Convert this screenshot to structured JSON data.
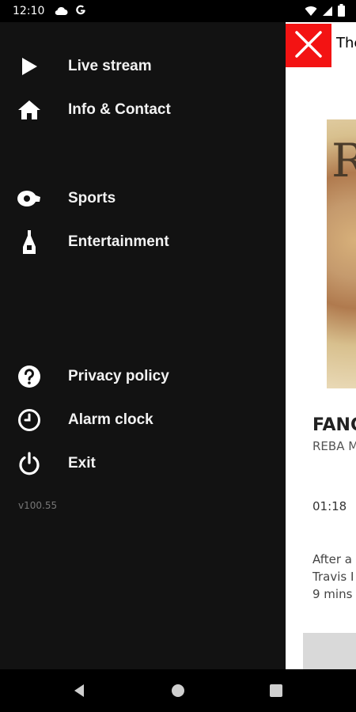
{
  "status_bar": {
    "time": "12:10",
    "left_icons": [
      "cloud-icon",
      "google-g-icon"
    ],
    "right_icons": [
      "wifi-icon",
      "signal-icon",
      "battery-icon"
    ]
  },
  "drawer": {
    "items": [
      {
        "label": "Live stream",
        "icon": "play-icon"
      },
      {
        "label": "Info & Contact",
        "icon": "home-icon"
      },
      {
        "label": "Sports",
        "icon": "whistle-icon"
      },
      {
        "label": "Entertainment",
        "icon": "ink-bottle-icon"
      },
      {
        "label": "Privacy policy",
        "icon": "help-circle-icon"
      },
      {
        "label": "Alarm clock",
        "icon": "clock-icon"
      },
      {
        "label": "Exit",
        "icon": "power-icon"
      }
    ],
    "version": "v100.55"
  },
  "content": {
    "header_title": "The",
    "close_icon": "close-icon",
    "album_letter": "R",
    "song_title": "FANC",
    "song_artist": "REBA M",
    "song_time": "01:18",
    "description_lines": [
      "After a",
      "Travis I",
      "9 mins"
    ]
  },
  "nav_bar": {
    "icons": [
      "back-icon",
      "home-circle-icon",
      "recents-icon"
    ]
  },
  "colors": {
    "drawer_bg": "#121212",
    "close_button_bg": "#f31313",
    "content_bg": "#ffffff"
  }
}
